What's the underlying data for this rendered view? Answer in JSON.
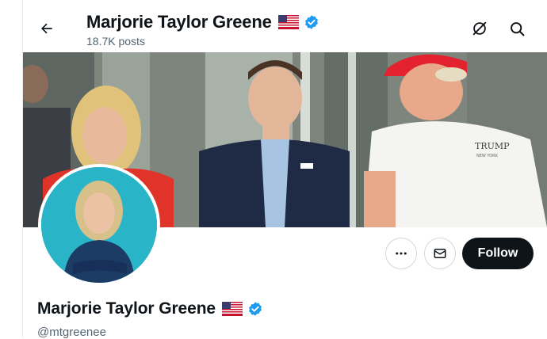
{
  "header": {
    "display_name": "Marjorie Taylor Greene",
    "post_count": "18.7K posts",
    "flag_icon": "us-flag-icon",
    "verified_icon": "verified-badge-icon",
    "back_icon": "arrow-left-icon",
    "grok_icon": "grok-icon",
    "search_icon": "search-icon"
  },
  "banner": {
    "shirt_logo_text": "TRUMP",
    "shirt_logo_sub": "NEW YORK"
  },
  "profile": {
    "display_name": "Marjorie Taylor Greene",
    "handle": "@mtgreenee",
    "follow_label": "Follow",
    "more_icon": "more-dots-icon",
    "message_icon": "envelope-icon"
  },
  "colors": {
    "follow_bg": "#0f1419",
    "verified_blue": "#1d9bf0",
    "muted_text": "#536471",
    "avatar_bg": "#2ab4c7"
  }
}
